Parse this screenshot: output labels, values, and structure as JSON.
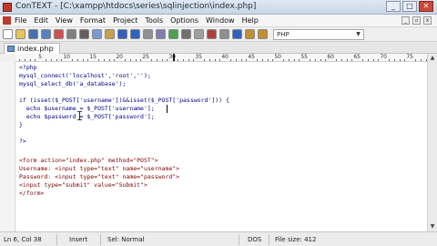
{
  "window": {
    "title": "ConTEXT - [C:\\xampp\\htdocs\\series\\sqlinjection\\index.php]",
    "min": "_",
    "max": "□",
    "close": "✕"
  },
  "menu": {
    "items": [
      "File",
      "Edit",
      "View",
      "Format",
      "Project",
      "Tools",
      "Options",
      "Window",
      "Help"
    ]
  },
  "toolbar": {
    "highlighter": "PHP",
    "icons": [
      {
        "name": "new-file-icon",
        "color": "#ffffff"
      },
      {
        "name": "open-folder-icon",
        "color": "#e8c35a"
      },
      {
        "name": "save-icon",
        "color": "#4a6fb0"
      },
      {
        "name": "save-all-icon",
        "color": "#5a7fc0"
      },
      {
        "name": "close-file-icon",
        "color": "#d05050"
      },
      {
        "name": "print-icon",
        "color": "#808080"
      },
      {
        "name": "cut-icon",
        "color": "#606060"
      },
      {
        "name": "copy-icon",
        "color": "#7a9ad0"
      },
      {
        "name": "paste-icon",
        "color": "#c8a050"
      },
      {
        "name": "undo-icon",
        "color": "#3060c0"
      },
      {
        "name": "redo-icon",
        "color": "#3060c0"
      },
      {
        "name": "find-icon",
        "color": "#909090"
      },
      {
        "name": "replace-icon",
        "color": "#8080b0"
      },
      {
        "name": "user-exec-icon",
        "color": "#50a050"
      },
      {
        "name": "wrap-icon",
        "color": "#707070"
      },
      {
        "name": "tools-icon",
        "color": "#a0a0a0"
      },
      {
        "name": "macro-icon",
        "color": "#b04040"
      },
      {
        "name": "settings-icon",
        "color": "#909090"
      },
      {
        "name": "help-icon",
        "color": "#3060c0"
      },
      {
        "name": "exec1-icon",
        "color": "#c09030"
      },
      {
        "name": "exec2-icon",
        "color": "#c09030"
      }
    ]
  },
  "tabs": [
    {
      "label": "index.php"
    }
  ],
  "ruler": {
    "labels": [
      "5",
      "10",
      "15",
      "20",
      "25",
      "30",
      "35",
      "40",
      "45",
      "50",
      "55",
      "60",
      "65",
      "70",
      "75"
    ]
  },
  "code": {
    "lines": [
      "<?php",
      "mysql_connect('localhost','root','');",
      "mysql_select_db('a_database');",
      "",
      "if (isset($_POST['username'])&&isset($_POST['password'])) {",
      "  echo $username = $_POST['username'];",
      "  echo $password = $_POST['password'];",
      "}",
      "",
      "?>",
      "",
      "<form action=\"index.php\" method=\"POST\">",
      "Username: <input type=\"text\" name=\"username\">",
      "Password: <input type=\"text\" name=\"password\">",
      "<input type=\"submit\" value=\"Submit\">",
      "</form>"
    ]
  },
  "status": {
    "position": "Ln 6, Col 38",
    "mode": "Insert",
    "selection": "Sel: Normal",
    "format": "DOS",
    "filesize": "File size: 412"
  }
}
